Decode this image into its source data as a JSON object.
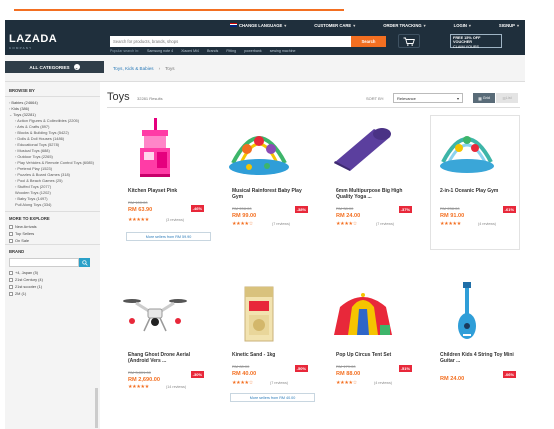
{
  "topbar": {
    "items": [
      {
        "label": "CHANGE LANGUAGE"
      },
      {
        "label": "CUSTOMER CARE"
      },
      {
        "label": "ORDER TRACKING"
      },
      {
        "label": "LOGIN"
      },
      {
        "label": "SIGNUP"
      }
    ]
  },
  "header": {
    "logo": "LAZADA",
    "logo_sub": "COMPANY",
    "search_placeholder": "Search for products, brands, shops",
    "search_button": "Search",
    "popular_label": "Popular search in:",
    "popular_terms": [
      "Samsung note 4",
      "Xiaomi Mi4",
      "Brands",
      "Fitting",
      "powerbank",
      "sewing machine"
    ],
    "voucher_line1": "FREE 15% OFF VOUCHER",
    "voucher_line2": "CLAIM YOURS"
  },
  "catbar": {
    "all_categories": "ALL CATEGORIES",
    "breadcrumb": [
      "Toys, Kids & Babies",
      "›",
      "Toys"
    ]
  },
  "sidebar": {
    "browse_by": "BROWSE BY",
    "items": [
      {
        "label": "Babies (24664)",
        "type": "top"
      },
      {
        "label": "Kids (386)",
        "type": "top"
      },
      {
        "label": "Toys (32281)",
        "type": "top-open"
      },
      {
        "label": "Action Figures & Collectibles (2205)",
        "type": "sub"
      },
      {
        "label": "Arts & Crafts (897)",
        "type": "sub"
      },
      {
        "label": "Blocks & Building Toys (5422)",
        "type": "sub"
      },
      {
        "label": "Dolls & Doll Houses (1486)",
        "type": "sub"
      },
      {
        "label": "Educational Toys (5278)",
        "type": "sub"
      },
      {
        "label": "Musical Toys (688)",
        "type": "sub"
      },
      {
        "label": "Outdoor Toys (2265)",
        "type": "sub"
      },
      {
        "label": "Play Vehicles & Remote Control Toys (6085)",
        "type": "sub"
      },
      {
        "label": "Pretend Play (1523)",
        "type": "sub"
      },
      {
        "label": "Puzzles & Board Games (318)",
        "type": "sub"
      },
      {
        "label": "Pool & Beach Games (25)",
        "type": "sub"
      },
      {
        "label": "Stuffed Toys (2077)",
        "type": "sub"
      },
      {
        "label": "Wooden Toys (1202)",
        "type": "sub-plain"
      },
      {
        "label": "Baby Toys (1497)",
        "type": "sub"
      },
      {
        "label": "Pull Along Toys (334)",
        "type": "sub-plain"
      }
    ],
    "explore_head": "MORE TO EXPLORE",
    "explore_items": [
      "New Arrivals",
      "Top Sellers",
      "On Sale"
    ],
    "brand_head": "BRAND",
    "brand_items": [
      "+4, Japan (5)",
      "21st Century (4)",
      "21st scooter (1)",
      "2M (1)"
    ]
  },
  "main": {
    "title": "Toys",
    "results": "32281 Results",
    "sort_label": "SORT BY:",
    "sort_value": "Relevance",
    "view_grid": "Grid",
    "view_list": "List"
  },
  "products": [
    {
      "name": "Kitchen Playset Pink",
      "old": "RM 100.00",
      "price": "RM 63.90",
      "disc": "-46%",
      "stars": 3,
      "reviews": "(3 reviews)",
      "more": "More sellers from RM 59.90",
      "icon": "kitchen-playset"
    },
    {
      "name": "Musical Rainforest Baby Play Gym",
      "old": "RM 208.00",
      "price": "RM 99.00",
      "disc": "-38%",
      "stars": 4,
      "reviews": "(7 reviews)",
      "more": "",
      "icon": "play-gym"
    },
    {
      "name": "6mm Multipurpose Big High Quality Yoga ...",
      "old": "RM 38.00",
      "price": "RM 24.00",
      "disc": "-37%",
      "stars": 4,
      "reviews": "(7 reviews)",
      "more": "",
      "icon": "yoga-mat"
    },
    {
      "name": "2-in-1 Oceanic Play Gym",
      "old": "RM 238.00",
      "price": "RM 91.00",
      "disc": "-61%",
      "stars": 5,
      "reviews": "(4 reviews)",
      "more": "",
      "icon": "oceanic-gym"
    },
    {
      "name": "Ehang Ghost Drone Aerial (Android Vers ...",
      "old": "RM 3,801.00",
      "price": "RM 2,690.00",
      "disc": "-30%",
      "stars": 5,
      "reviews": "(14 reviews)",
      "more": "",
      "icon": "drone"
    },
    {
      "name": "Kinetic Sand - 1kg",
      "old": "RM 80.00",
      "price": "RM 40.00",
      "disc": "-50%",
      "stars": 4,
      "reviews": "(7 reviews)",
      "more": "More sellers from RM 40.00",
      "icon": "kinetic-sand"
    },
    {
      "name": "Pop Up Circus Tent Set",
      "old": "RM 179.00",
      "price": "RM 88.00",
      "disc": "-51%",
      "stars": 4,
      "reviews": "(4 reviews)",
      "more": "",
      "icon": "circus-tent"
    },
    {
      "name": "Children Kids 4 String Toy Mini Guitar ...",
      "old": "RM 30.00",
      "price": "RM 24.00",
      "disc": "-06%",
      "stars": 0,
      "reviews": "",
      "more": "",
      "icon": "guitar"
    }
  ],
  "colors": {
    "brand_dark": "#1f2f3c",
    "accent": "#f36f21",
    "discount": "#e8283a",
    "link": "#2b7bb9"
  }
}
